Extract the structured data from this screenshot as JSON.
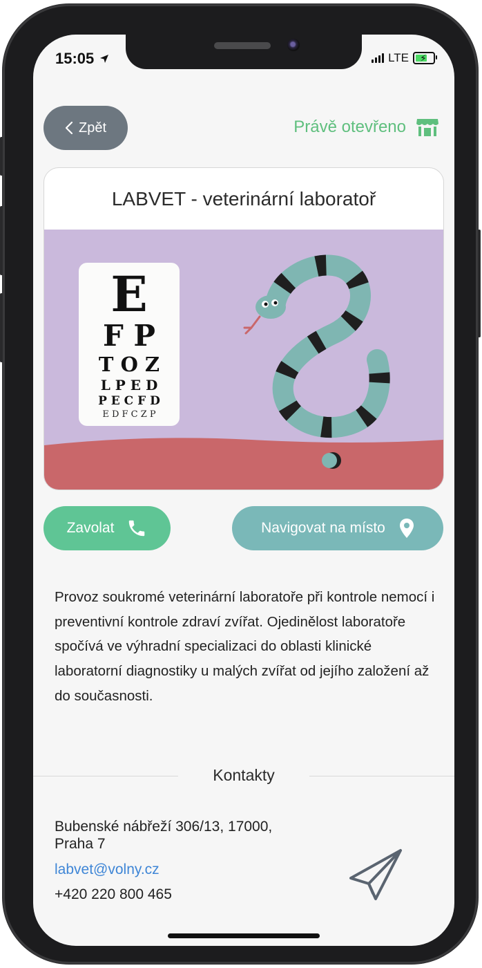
{
  "status_bar": {
    "time": "15:05",
    "network": "LTE"
  },
  "header": {
    "back_label": "Zpět",
    "open_status": "Právě otevřeno"
  },
  "card": {
    "title": "LABVET - veterinární laboratoř"
  },
  "eye_chart": {
    "rows": [
      "E",
      "F P",
      "T O Z",
      "L P E D",
      "P E C F D",
      "E D F C Z P"
    ]
  },
  "actions": {
    "call_label": "Zavolat",
    "navigate_label": "Navigovat na místo"
  },
  "description": "Provoz soukromé veterinární laboratoře při kontrole nemocí i preventivní kontrole zdraví zvířat. Ojedinělost laboratoře spočívá ve výhradní specializaci do oblasti klinické laboratorní diagnostiky u malých zvířat od jejího založení až do současnosti.",
  "contacts": {
    "title": "Kontakty",
    "address_line1": "Bubenské nábřeží 306/13, 17000,",
    "address_line2": "Praha 7",
    "email": "labvet@volny.cz",
    "phone": "+420 220 800 465"
  },
  "colors": {
    "back_button": "#6d7780",
    "open_status": "#5fbf7e",
    "call_button": "#5fc595",
    "navigate_button": "#7ab8b8",
    "email_link": "#3f86d6",
    "image_background": "#cab9dc",
    "image_ground": "#c9676a"
  },
  "icons": {
    "back": "chevron-left-icon",
    "open_status": "shop-icon",
    "call": "phone-icon",
    "navigate": "map-pin-icon",
    "send": "paper-plane-icon",
    "status_location": "location-arrow-icon"
  }
}
